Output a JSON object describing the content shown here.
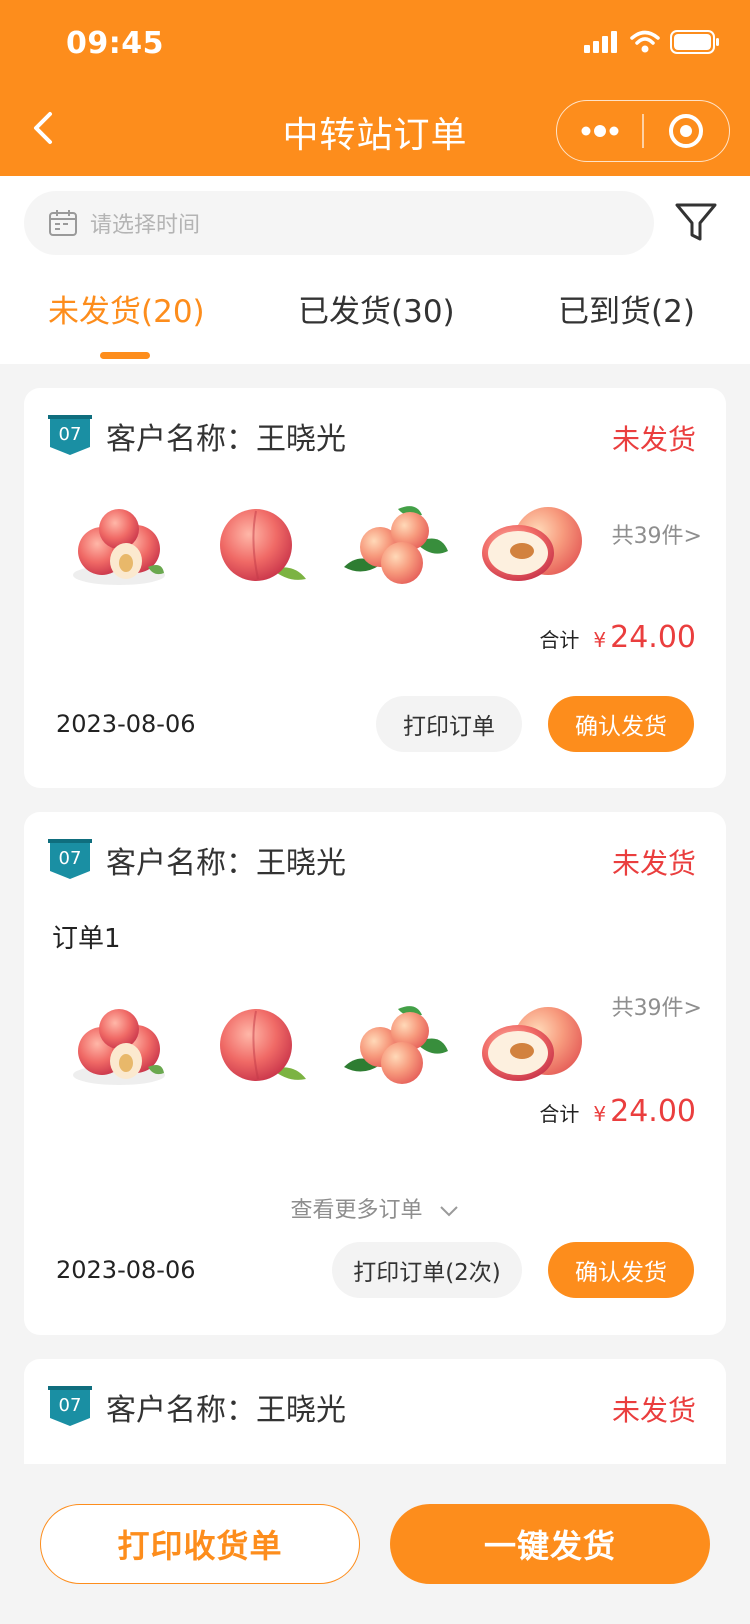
{
  "status_bar": {
    "time": "09:45"
  },
  "header": {
    "title": "中转站订单"
  },
  "search": {
    "placeholder": "请选择时间"
  },
  "tabs": [
    {
      "label": "未发货(20)",
      "active": true
    },
    {
      "label": "已发货(30)",
      "active": false
    },
    {
      "label": "已到货(2)",
      "active": false
    }
  ],
  "orders": [
    {
      "badge": "07",
      "customer": "客户名称：王晓光",
      "status": "未发货",
      "product_images": [
        "peaches-plate",
        "single-peach",
        "peaches-with-leaves",
        "halved-peach"
      ],
      "count": "共39件>",
      "total_label": "合计",
      "currency": "¥",
      "amount": "24.00",
      "date": "2023-08-06",
      "print_label": "打印订单",
      "confirm_label": "确认发货"
    },
    {
      "badge": "07",
      "customer": "客户名称：王晓光",
      "status": "未发货",
      "order_name": "订单1",
      "product_images": [
        "peaches-plate",
        "single-peach",
        "peaches-with-leaves",
        "halved-peach"
      ],
      "count": "共39件>",
      "total_label": "合计",
      "currency": "¥",
      "amount": "24.00",
      "expand_label": "查看更多订单",
      "date": "2023-08-06",
      "print_label": "打印订单(2次)",
      "confirm_label": "确认发货"
    },
    {
      "badge": "07",
      "customer": "客户名称：王晓光",
      "status": "未发货"
    }
  ],
  "bottom": {
    "print_receipt": "打印收货单",
    "ship_all": "一键发货"
  },
  "colors": {
    "accent": "#fd8d1c",
    "status_red": "#ea3e3e",
    "badge_teal": "#1a8fa3"
  }
}
